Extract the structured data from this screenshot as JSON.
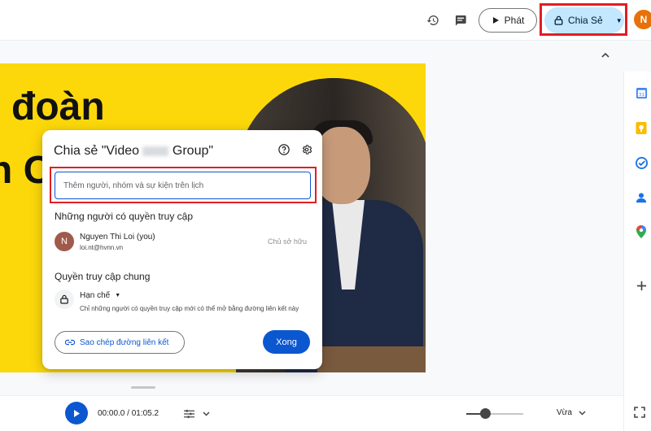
{
  "header": {
    "play_label": "Phát",
    "share_label": "Chia Sẻ",
    "avatar_initial": "N"
  },
  "slide": {
    "title_line1": "đoàn",
    "title_line2": "n C"
  },
  "share_dialog": {
    "title_prefix": "Chia sẻ \"Video ",
    "title_suffix": " Group\"",
    "input_placeholder": "Thêm người, nhóm và sự kiện trên lịch",
    "people_heading": "Những người có quyền truy cập",
    "person": {
      "initial": "N",
      "name": "Nguyen Thi Loi (you)",
      "email": "loi.nt@hvnn.vn",
      "role": "Chủ sở hữu"
    },
    "general_heading": "Quyền truy cập chung",
    "access_level": "Hạn chế",
    "access_description": "Chỉ những người có quyền truy cập mới có thể mở bằng đường liên kết này",
    "copy_link_label": "Sao chép đường liên kết",
    "done_label": "Xong"
  },
  "player": {
    "time": "00:00.0 / 01:05.2",
    "zoom_label": "Vừa",
    "zoom_level": 0.33
  },
  "colors": {
    "accent": "#0b57d0",
    "share_bg": "#c2e7ff",
    "slide_bg": "#fcd80a",
    "highlight": "#e01e24"
  }
}
